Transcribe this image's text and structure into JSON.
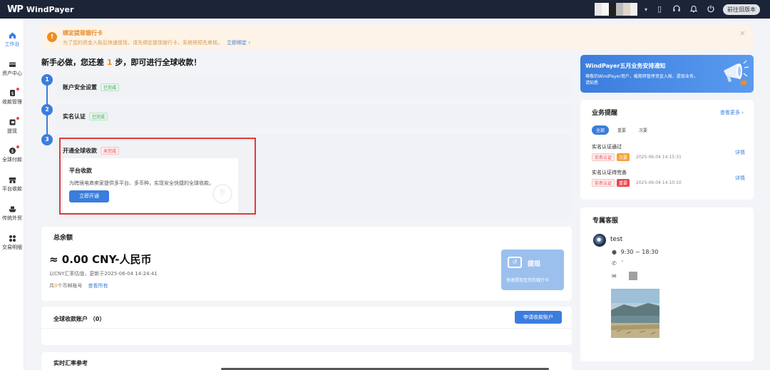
{
  "topbar": {
    "logo_mark": "WP",
    "logo_text": "WindPayer",
    "old_version_label": "前往旧版本",
    "colors": {
      "background": "#1c2438"
    },
    "icons": [
      "mobile-icon",
      "headset-icon",
      "bell-icon",
      "power-icon"
    ]
  },
  "sidebar": {
    "items": [
      {
        "label": "工作台",
        "icon": "home-icon",
        "active": true
      },
      {
        "label": "资产中心",
        "icon": "wallet-icon"
      },
      {
        "label": "收款管理",
        "icon": "receipt-icon",
        "badge": true
      },
      {
        "label": "提现",
        "icon": "withdraw-icon",
        "badge": true
      },
      {
        "label": "全球付款",
        "icon": "dollar-icon",
        "badge": true
      },
      {
        "label": "平台收款",
        "icon": "store-icon"
      },
      {
        "label": "传统外贸",
        "icon": "ship-icon"
      },
      {
        "label": "交易明细",
        "icon": "list-icon"
      }
    ]
  },
  "notice": {
    "title": "绑定提现银行卡",
    "text": "为了您的资金入账后快速提现，请先绑定提现银行卡，系统将预先审核。",
    "link": "立即绑定",
    "link_arrow": "›",
    "close": "×"
  },
  "onboarding": {
    "headline_prefix": "新手必做，您还差",
    "headline_count": "1",
    "headline_suffix": "步，即可进行全球收款！",
    "steps": [
      {
        "num": "1",
        "title": "账户安全设置",
        "status": "已完成"
      },
      {
        "num": "2",
        "title": "实名认证",
        "status": "已完成"
      },
      {
        "num": "3",
        "title": "开通全球收款",
        "status": "未完成"
      }
    ],
    "platform": {
      "title": "平台收款",
      "desc": "为跨境电商卖家提供多平台、多币种，实现安全快捷的全球收款。",
      "button": "立即开通",
      "watermark": "手"
    }
  },
  "balance": {
    "title": "总余额",
    "amount": "≈ 0.00 CNY-人民币",
    "sub": "以CNY汇率估值，更新于2025-06-04 14:24:41",
    "accounts_prefix": "共",
    "accounts_count": "0",
    "accounts_suffix": "个币种账号",
    "view_all": "查看所有",
    "withdraw": {
      "label": "提现",
      "sub": "快速提现至您的银行卡"
    }
  },
  "global_accounts": {
    "title": "全球收款账户 （0）",
    "apply_button": "申请收款账户"
  },
  "rates": {
    "title": "实时汇率参考"
  },
  "promo": {
    "title": "WindPayer五月业务安排通知",
    "text": "尊敬的WindPayer用户，截期将暂停资金入账、提现业务，请知悉"
  },
  "business": {
    "title": "业务提醒",
    "more": "查看更多",
    "more_arrow": "›",
    "tabs": [
      {
        "label": "全部",
        "active": true
      },
      {
        "label": "重要"
      },
      {
        "label": "次要"
      }
    ],
    "items": [
      {
        "title": "实名认证通过",
        "tag": "实名认证",
        "level": "次要",
        "time": "2025-06-04 14:15:31",
        "detail": "详情"
      },
      {
        "title": "实名认证待完善",
        "tag": "实名认证",
        "level": "重要",
        "time": "2025-06-04 14:10:10",
        "detail": "详情"
      }
    ]
  },
  "service": {
    "title": "专属客服",
    "name": "test",
    "hours": "9:30 ~ 18:30",
    "phone": "´",
    "email": ""
  }
}
